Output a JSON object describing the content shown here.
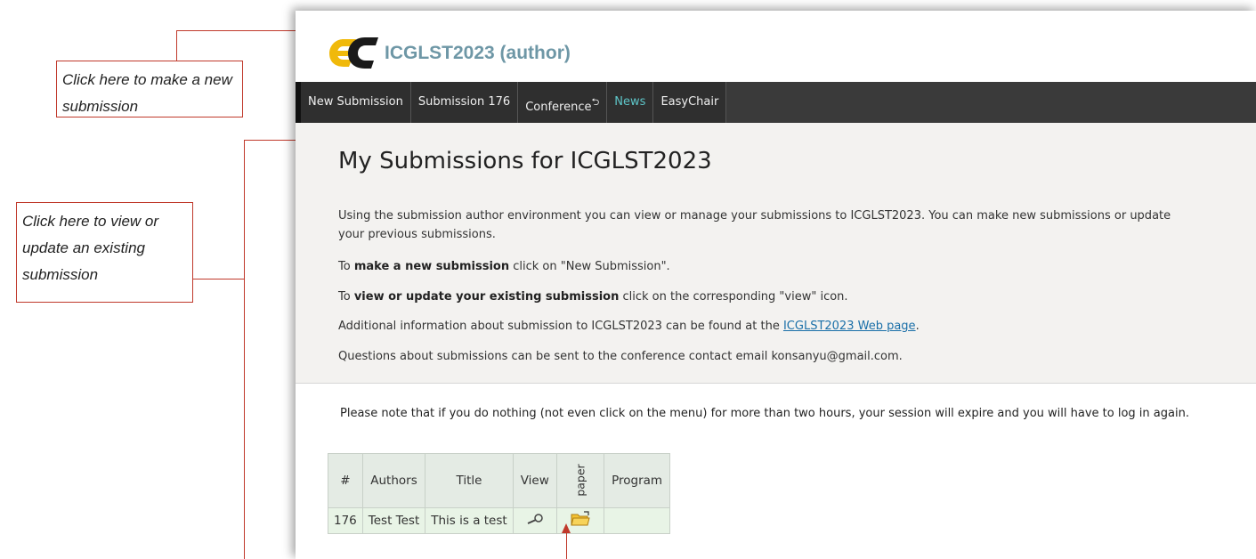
{
  "app": {
    "title": "ICGLST2023 (author)"
  },
  "menu": {
    "items": [
      {
        "label": "New Submission"
      },
      {
        "label": "Submission 176"
      },
      {
        "label": "Conference",
        "suffix_icon": "return-arrow-icon"
      },
      {
        "label": "News"
      },
      {
        "label": "EasyChair"
      }
    ]
  },
  "page": {
    "heading": "My Submissions for ICGLST2023",
    "intro": "Using the submission author environment you can view or manage your submissions to ICGLST2023. You can make new submissions or update your previous submissions.",
    "new_prefix": "To ",
    "new_bold": "make a new submission",
    "new_suffix": " click on \"New Submission\".",
    "view_prefix": "To ",
    "view_bold": "view or update your existing submission",
    "view_suffix": " click on the corresponding \"view\" icon.",
    "addl_prefix": "Additional information about submission to ICGLST2023 can be found at the ",
    "addl_link": "ICGLST2023 Web page",
    "addl_suffix": ".",
    "questions": "Questions about submissions can be sent to the conference contact email konsanyu@gmail.com.",
    "notice": "Please note that if you do nothing (not even click on the menu) for more than two hours, your session will expire and you will have to log in again."
  },
  "table": {
    "headers": {
      "num": "#",
      "authors": "Authors",
      "title": "Title",
      "view": "View",
      "paper": "paper",
      "program": "Program"
    },
    "rows": [
      {
        "num": "176",
        "authors": "Test Test",
        "title": "This is a test",
        "view_icon": "magnifier-icon",
        "paper_icon": "folder-icon",
        "program": ""
      }
    ]
  },
  "annotations": {
    "new_submission": "Click here to make a new submission",
    "existing_submission": "Click here to view or update an existing submission"
  },
  "colors": {
    "accent": "#c0392b",
    "title": "#6e97a6",
    "menubar": "#3a3a3a",
    "news": "#5ec6c9"
  }
}
